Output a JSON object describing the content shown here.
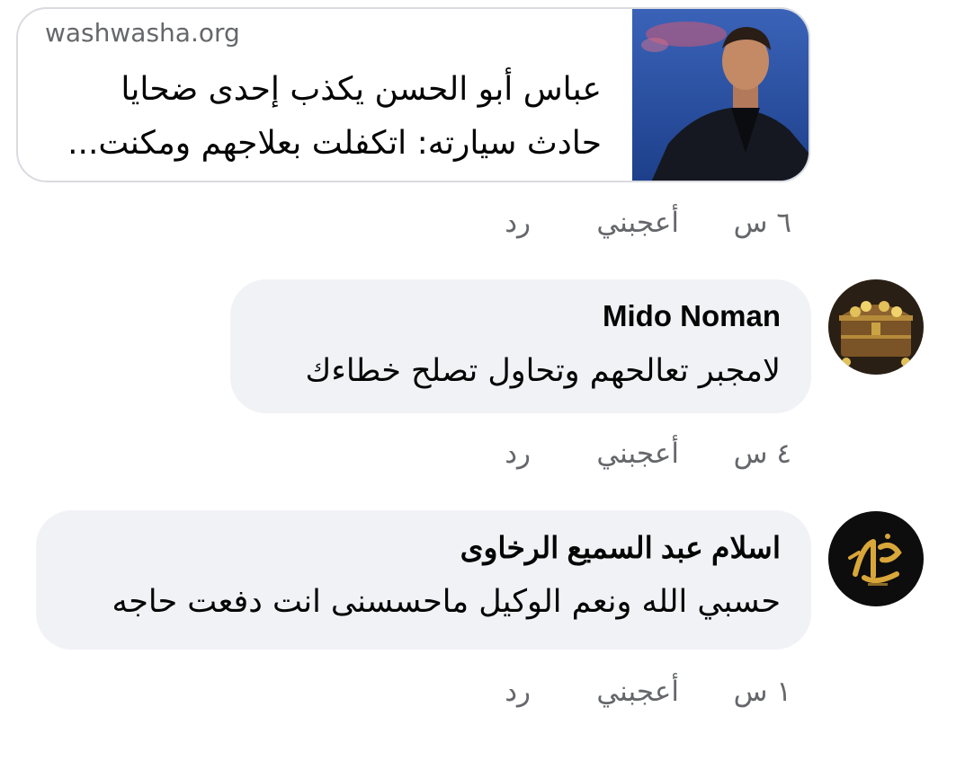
{
  "link_preview": {
    "domain": "washwasha.org",
    "title": "عباس أبو الحسن يكذب إحدى ضحايا حادث سيارته: اتكفلت بعلاجهم ومكنت..."
  },
  "post_actions": {
    "time": "٦ س",
    "like": "أعجبني",
    "reply": "رد"
  },
  "comments": [
    {
      "author": "Mido Noman",
      "text": "لامجبر تعالحهم وتحاول تصلح خطاءك",
      "time": "٤ س",
      "like": "أعجبني",
      "reply": "رد"
    },
    {
      "author": "اسلام عبد السميع الرخاوى",
      "text": "حسبي الله ونعم الوكيل ماحسسنى انت دفعت حاجه",
      "time": "١ س",
      "like": "أعجبني",
      "reply": "رد"
    }
  ],
  "colors": {
    "bubble": "#f0f2f5",
    "secondary_text": "#65676b",
    "primary_text": "#050505",
    "card_border": "#d9dbe0"
  }
}
